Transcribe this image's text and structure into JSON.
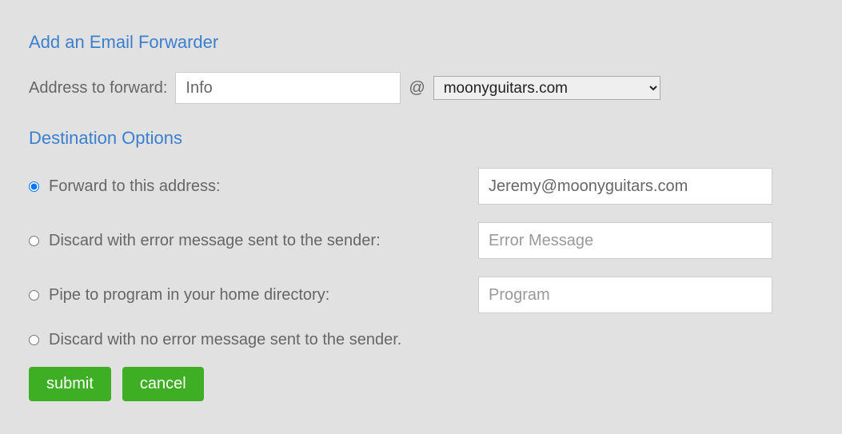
{
  "headings": {
    "main": "Add an Email Forwarder",
    "destination": "Destination Options"
  },
  "address": {
    "label": "Address to forward:",
    "value": "Info",
    "at": "@",
    "domain_selected": "moonyguitars.com"
  },
  "options": {
    "forward": {
      "label": "Forward to this address:",
      "value": "Jeremy@moonyguitars.com"
    },
    "discard_error": {
      "label": "Discard with error message sent to the sender:",
      "placeholder": "Error Message"
    },
    "pipe": {
      "label": "Pipe to program in your home directory:",
      "placeholder": "Program"
    },
    "discard_silent": {
      "label": "Discard with no error message sent to the sender."
    }
  },
  "buttons": {
    "submit": "submit",
    "cancel": "cancel"
  }
}
